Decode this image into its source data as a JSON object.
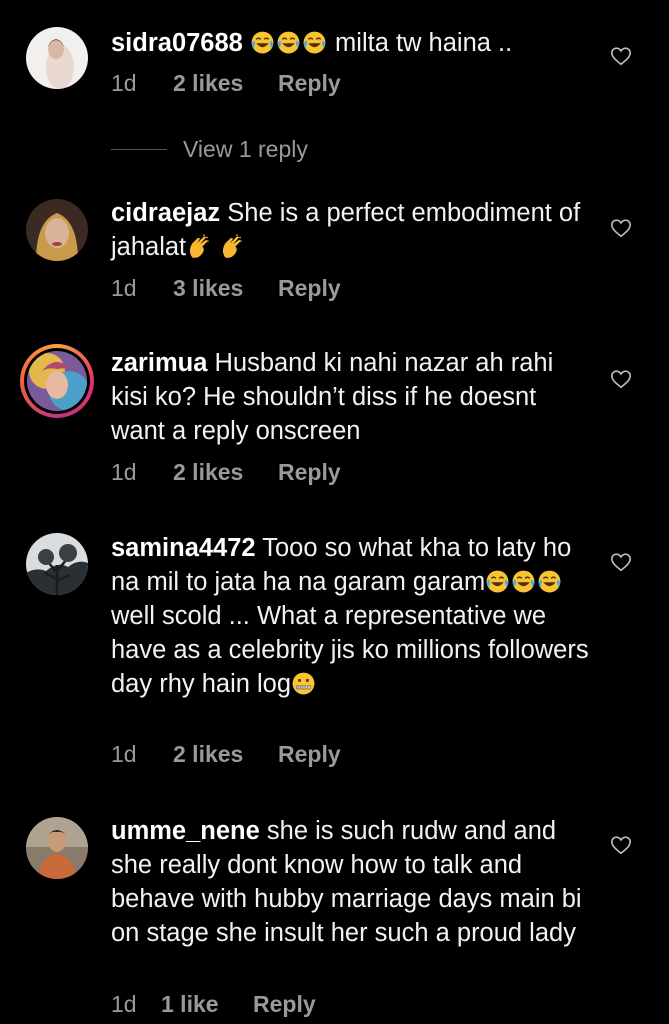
{
  "comments": [
    {
      "username": "sidra07688",
      "text_before": "",
      "text_after": " milta tw haina ..",
      "time": "1d",
      "likes": "2 likes",
      "reply": "Reply",
      "view_replies": "View 1 reply"
    },
    {
      "username": "cidraejaz",
      "text_before": "She is a perfect embodiment of jahalat",
      "time": "1d",
      "likes": "3 likes",
      "reply": "Reply"
    },
    {
      "username": "zarimua",
      "text_before": "Husband ki nahi nazar ah rahi kisi ko? He shouldn’t diss if he doesnt want a reply onscreen",
      "time": "1d",
      "likes": "2 likes",
      "reply": "Reply"
    },
    {
      "username": "samina4472",
      "text_before": "Tooo so what kha to laty ho na mil to jata ha na garam garam",
      "text_after": " well scold ... What a representative we have as a celebrity jis ko millions followers day rhy hain log",
      "time": "1d",
      "likes": "2 likes",
      "reply": "Reply"
    },
    {
      "username": "umme_nene",
      "text_before": "she is such rudw and and she really dont know how to talk and behave with hubby marriage days main bi on stage she insult her such a proud lady",
      "time": "1d",
      "likes": "1 like",
      "reply": "Reply"
    }
  ],
  "icons": {
    "heart": "heart-outline-icon",
    "laughing": "face-with-tears-of-joy-icon",
    "clap": "clapping-hands-icon",
    "zipper": "zipper-mouth-face-icon"
  },
  "colors": {
    "background": "#000000",
    "text": "#f2f2f2",
    "meta": "#9a9a9a"
  }
}
